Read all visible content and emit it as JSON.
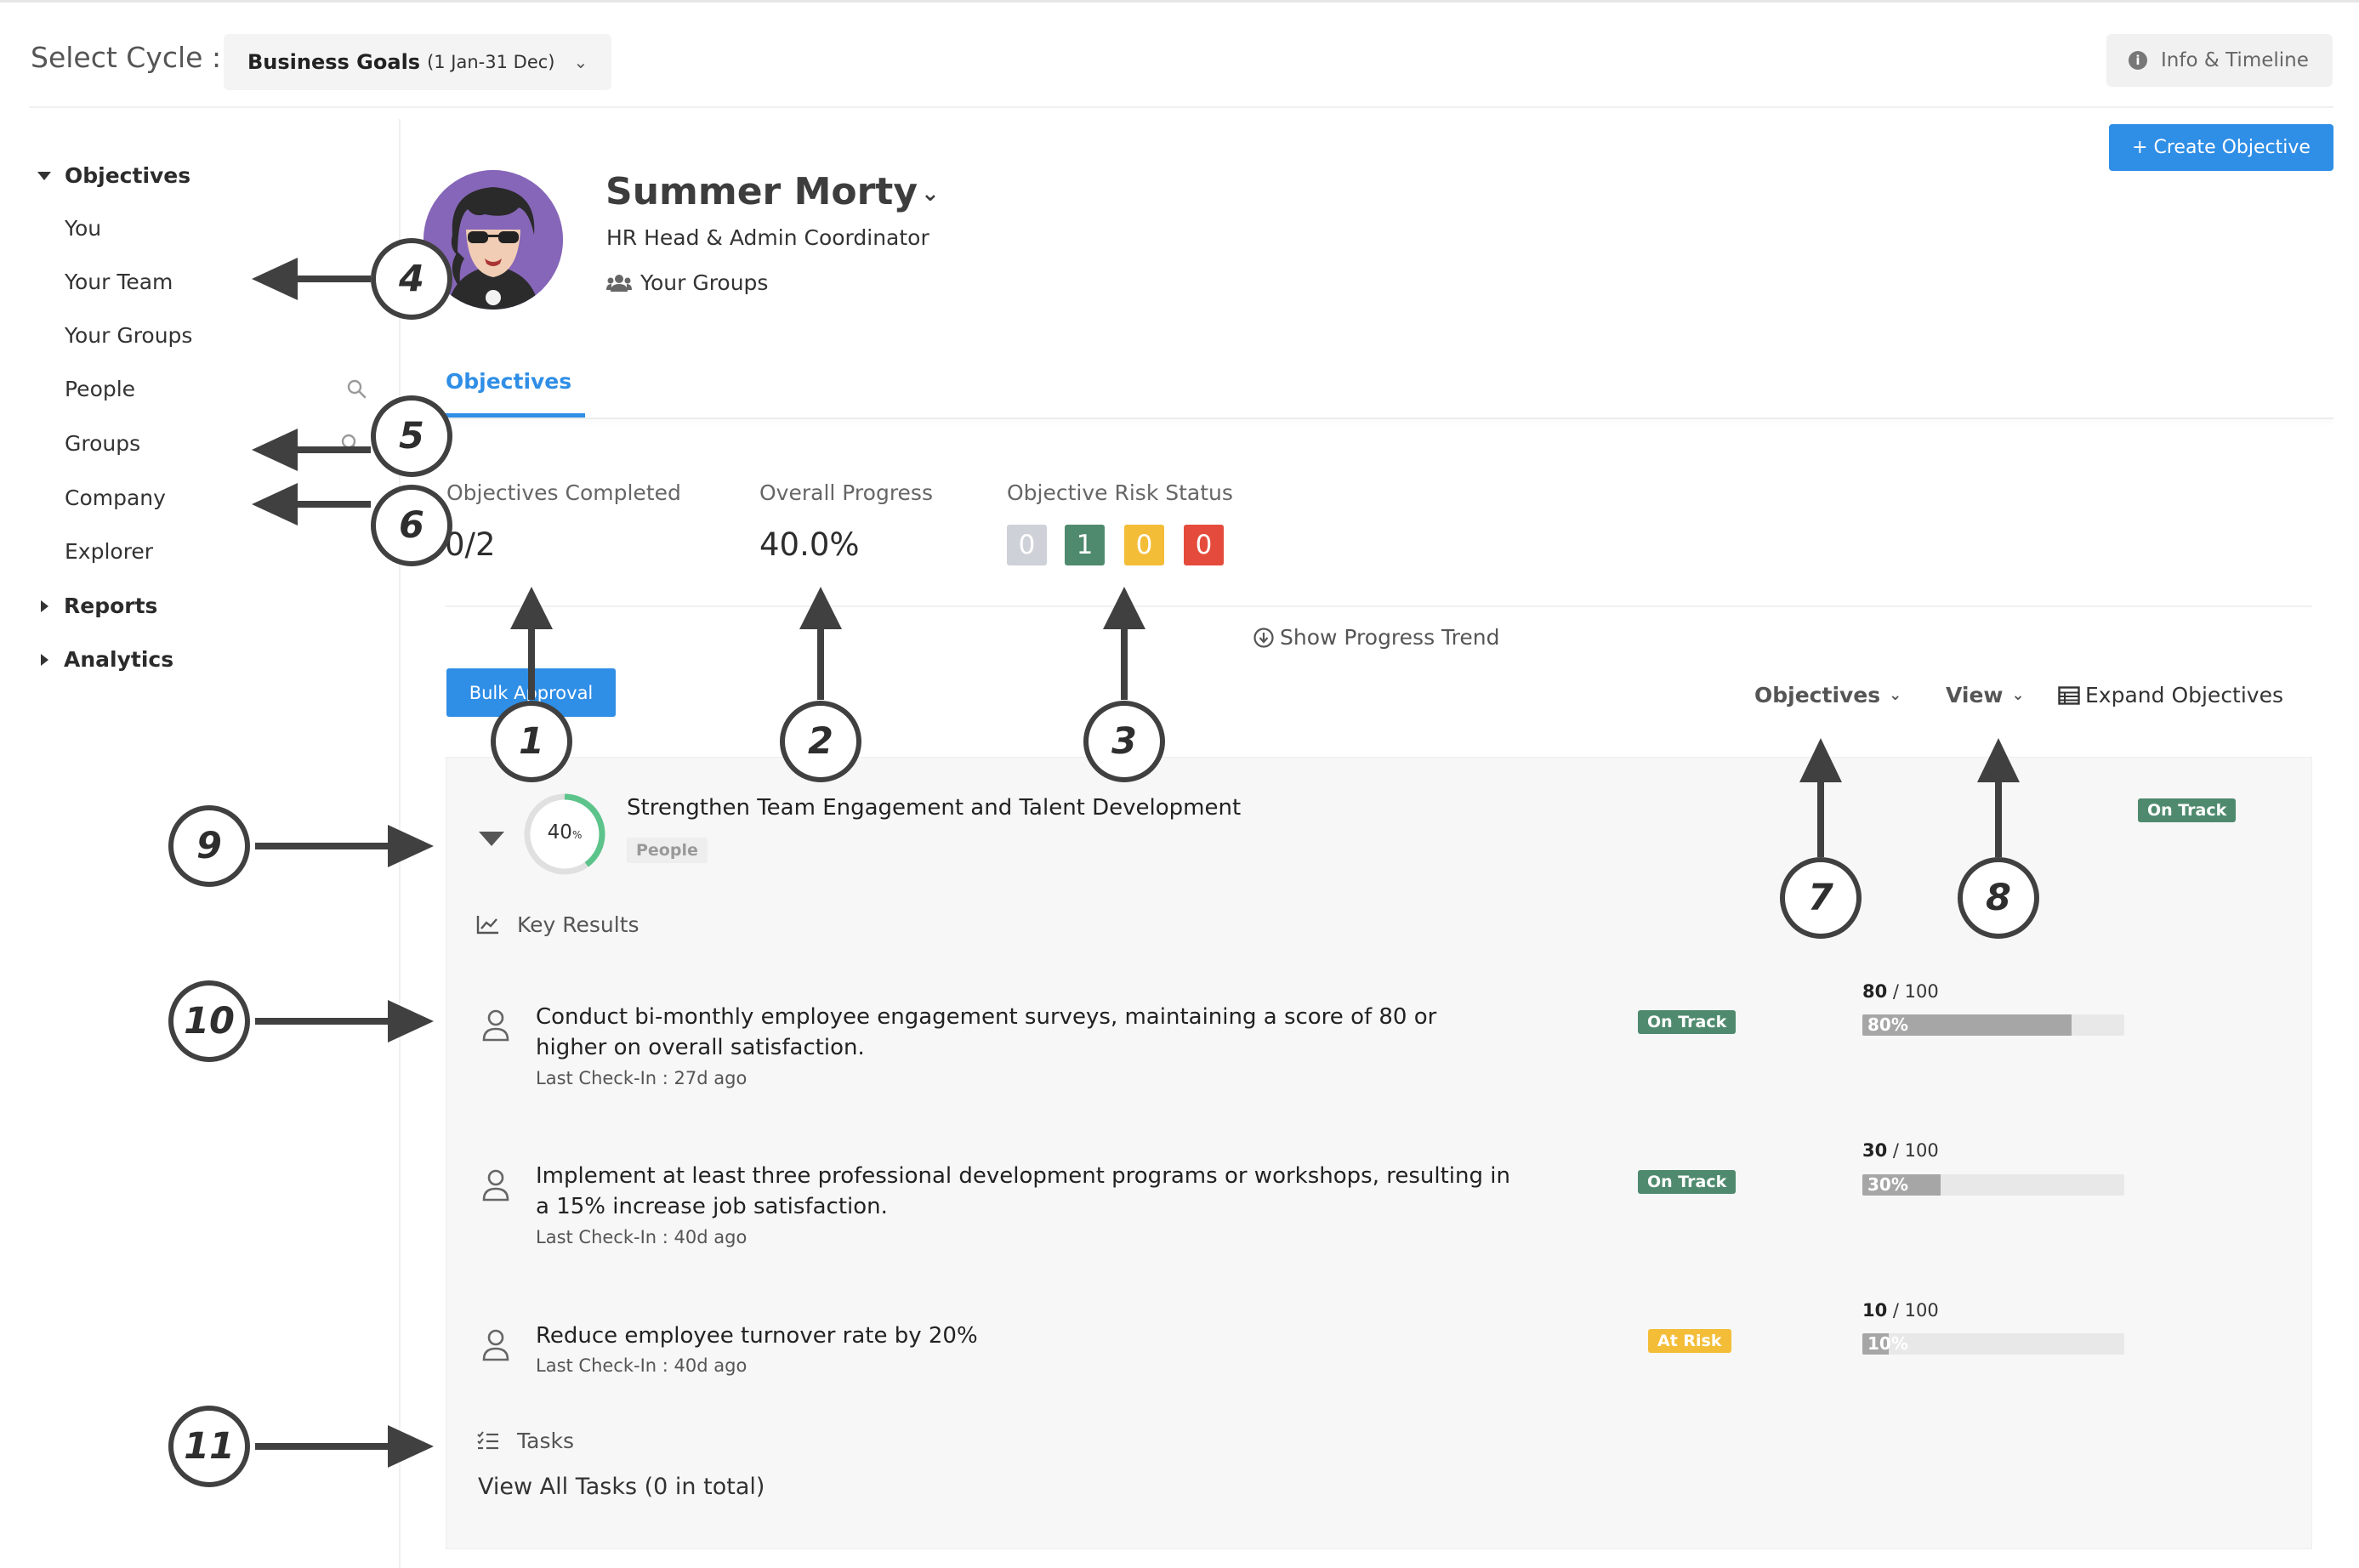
{
  "header": {
    "cycle_label": "Select Cycle :",
    "cycle_name": "Business Goals",
    "cycle_range": "(1 Jan-31 Dec)",
    "info_button": "Info & Timeline"
  },
  "sidebar": {
    "objectives_label": "Objectives",
    "items": [
      {
        "label": "You"
      },
      {
        "label": "Your Team"
      },
      {
        "label": "Your Groups"
      },
      {
        "label": "People"
      },
      {
        "label": "Groups"
      },
      {
        "label": "Company"
      },
      {
        "label": "Explorer"
      }
    ],
    "reports_label": "Reports",
    "analytics_label": "Analytics"
  },
  "profile": {
    "name": "Summer Morty",
    "role": "HR Head & Admin Coordinator",
    "groups_link": "Your Groups"
  },
  "actions": {
    "create_objective": "+ Create Objective",
    "bulk_approval": "Bulk Approval",
    "show_progress_trend": "Show Progress Trend",
    "objectives_dropdown": "Objectives",
    "view_dropdown": "View",
    "expand_objectives": "Expand Objectives"
  },
  "tabs": [
    {
      "label": "Objectives",
      "active": true
    }
  ],
  "stats": {
    "completed_label": "Objectives Completed",
    "completed_value": "0/2",
    "progress_label": "Overall Progress",
    "progress_value": "40.0%",
    "risk_label": "Objective Risk Status",
    "risk_counts": [
      {
        "value": "0",
        "color": "#cfd1d8"
      },
      {
        "value": "1",
        "color": "#4f8a6e"
      },
      {
        "value": "0",
        "color": "#f3bd38"
      },
      {
        "value": "0",
        "color": "#e54b3c"
      }
    ]
  },
  "objective": {
    "title": "Strengthen Team Engagement and Talent Development",
    "tag": "People",
    "progress_percent": 40,
    "progress_number": "40",
    "progress_unit": "%",
    "status": "On Track",
    "key_results_label": "Key Results",
    "key_results": [
      {
        "title": "Conduct bi-monthly employee engagement surveys, maintaining a score of 80 or higher on overall satisfaction.",
        "last_checkin": "Last Check-In : 27d ago",
        "status": "On Track",
        "current": "80",
        "target": "/ 100",
        "percent_label": "80%",
        "percent": 80
      },
      {
        "title": "Implement at least three professional development programs or workshops, resulting in a 15% increase job satisfaction.",
        "last_checkin": "Last Check-In : 40d ago",
        "status": "On Track",
        "current": "30",
        "target": "/ 100",
        "percent_label": "30%",
        "percent": 30
      },
      {
        "title": "Reduce employee turnover rate by 20%",
        "last_checkin": "Last Check-In : 40d ago",
        "status": "At Risk",
        "current": "10",
        "target": "/ 100",
        "percent_label": "10%",
        "percent": 10
      }
    ],
    "tasks_label": "Tasks",
    "view_all_tasks": "View All Tasks (0 in total)"
  },
  "annotations": [
    "1",
    "2",
    "3",
    "4",
    "5",
    "6",
    "7",
    "8",
    "9",
    "10",
    "11"
  ],
  "colors": {
    "accent": "#2f8ee6",
    "on_track": "#4f8a6e",
    "at_risk": "#f3bd38",
    "behind": "#e54b3c",
    "not_started": "#cfd1d8"
  }
}
